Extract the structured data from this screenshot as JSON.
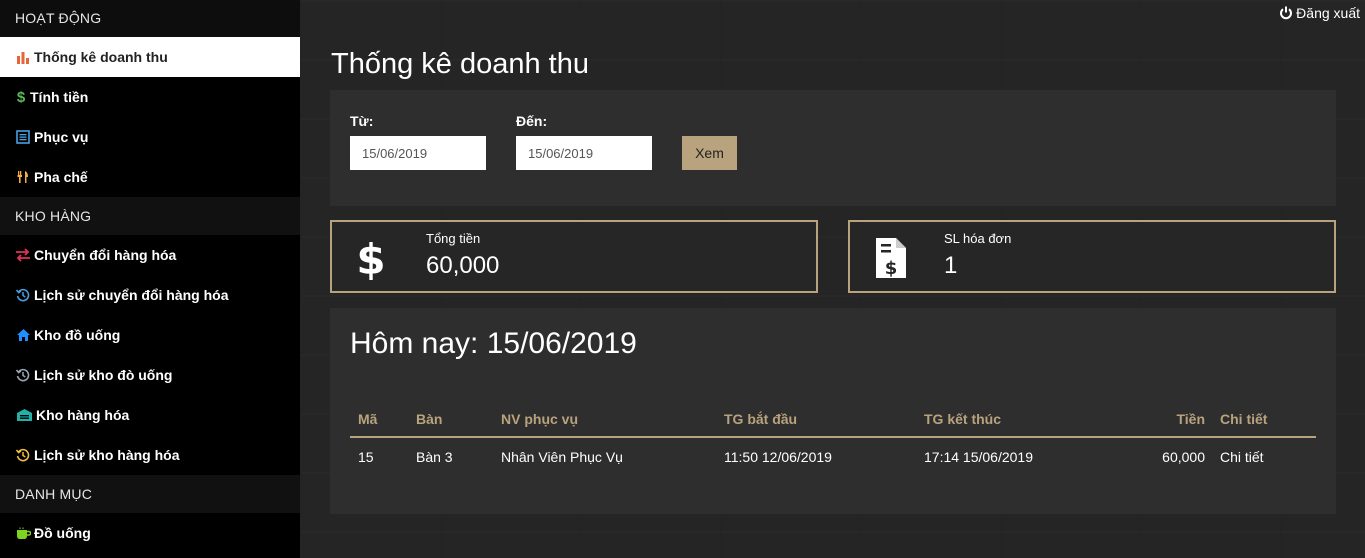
{
  "sidebar": {
    "sections": [
      {
        "header": "HOẠT ĐỘNG",
        "items": [
          {
            "label": "Thống kê doanh thu",
            "icon": "bar-chart-icon",
            "active": true
          },
          {
            "label": "Tính tiền",
            "icon": "dollar-icon"
          },
          {
            "label": "Phục vụ",
            "icon": "list-icon"
          },
          {
            "label": "Pha chế",
            "icon": "utensils-icon"
          }
        ]
      },
      {
        "header": "KHO HÀNG",
        "items": [
          {
            "label": "Chuyển đổi hàng hóa",
            "icon": "exchange-icon"
          },
          {
            "label": "Lịch sử chuyển đổi hàng hóa",
            "icon": "history-icon"
          },
          {
            "label": "Kho đồ uống",
            "icon": "home-icon"
          },
          {
            "label": "Lịch sử kho đò uống",
            "icon": "history-icon"
          },
          {
            "label": "Kho hàng hóa",
            "icon": "warehouse-icon"
          },
          {
            "label": "Lịch sử kho hàng hóa",
            "icon": "history-icon"
          }
        ]
      },
      {
        "header": "DANH MỤC",
        "items": [
          {
            "label": "Đồ uống",
            "icon": "coffee-icon"
          }
        ]
      }
    ]
  },
  "header": {
    "logout_label": "Đăng xuất",
    "page_title": "Thống kê doanh thu"
  },
  "filter": {
    "from_label": "Từ:",
    "from_value": "15/06/2019",
    "to_label": "Đến:",
    "to_value": "15/06/2019",
    "view_button": "Xem"
  },
  "stats": {
    "total": {
      "label": "Tổng tiền",
      "value": "60,000",
      "icon": "dollar-icon"
    },
    "invoices": {
      "label": "SL hóa đơn",
      "value": "1",
      "icon": "invoice-icon"
    }
  },
  "today": {
    "title": "Hôm nay: 15/06/2019",
    "columns": [
      "Mã",
      "Bàn",
      "NV phục vụ",
      "TG bắt đầu",
      "TG kết thúc",
      "Tiền",
      "Chi tiết"
    ],
    "rows": [
      [
        "15",
        "Bàn 3",
        "Nhân Viên Phục Vụ",
        "11:50 12/06/2019",
        "17:14 15/06/2019",
        "60,000",
        "Chi tiết"
      ]
    ]
  },
  "colors": {
    "accent": "#b9a27e",
    "sidebar_bg": "#000000",
    "main_bg": "#252525",
    "panel_bg": "#2e2e2e",
    "icon_chart": "#e8653a",
    "icon_dollar": "#5cb85c",
    "icon_list": "#4a9fe0",
    "icon_utensils": "#f0ad4e",
    "icon_exchange": "#e0335a",
    "icon_history_blue": "#4a9fe0",
    "icon_home": "#1e90ff",
    "icon_history_gray": "#9aa6b2",
    "icon_warehouse": "#20b2aa",
    "icon_history_yellow": "#f0c040",
    "icon_coffee": "#7ed321"
  }
}
